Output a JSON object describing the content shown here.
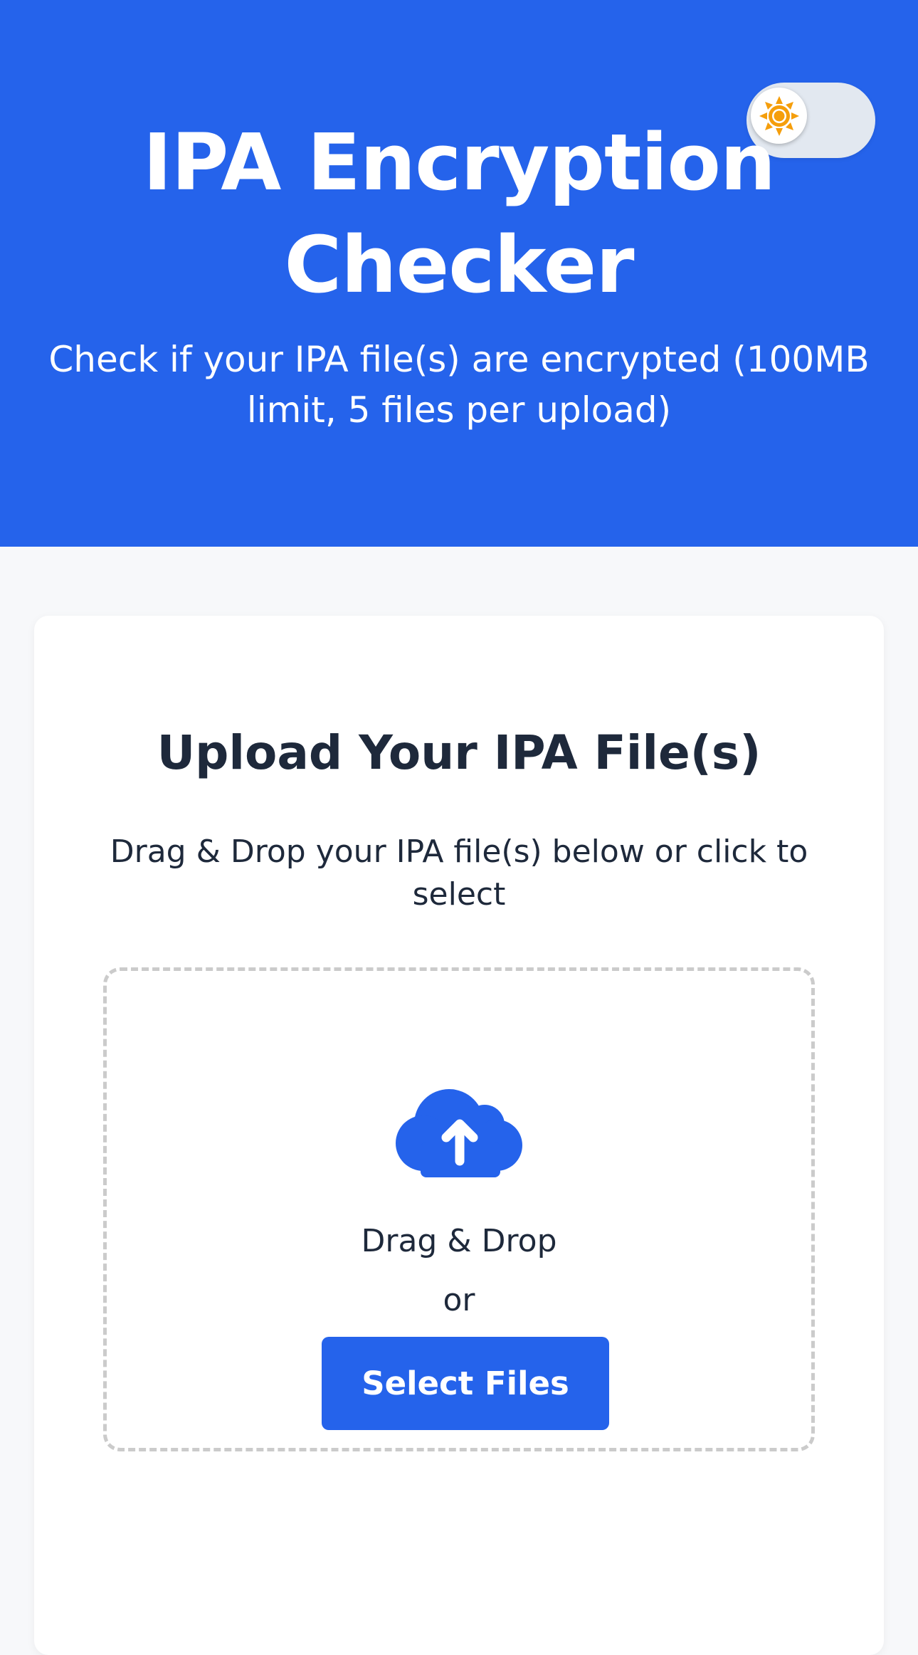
{
  "header": {
    "title": "IPA Encryption Checker",
    "subtitle": "Check if your IPA file(s) are encrypted (100MB limit, 5 files per upload)",
    "background_color": "#2563eb",
    "theme_toggle": {
      "icon": "sun-icon",
      "state": "light",
      "icon_color": "#f59e0b"
    }
  },
  "upload_card": {
    "title": "Upload Your IPA File(s)",
    "description": "Drag & Drop your IPA file(s) below or click to select",
    "dropzone": {
      "icon": "cloud-upload-icon",
      "icon_color": "#2563eb",
      "drag_text": "Drag & Drop",
      "or_text": "or",
      "button_label": "Select Files",
      "button_color": "#2563eb"
    }
  }
}
